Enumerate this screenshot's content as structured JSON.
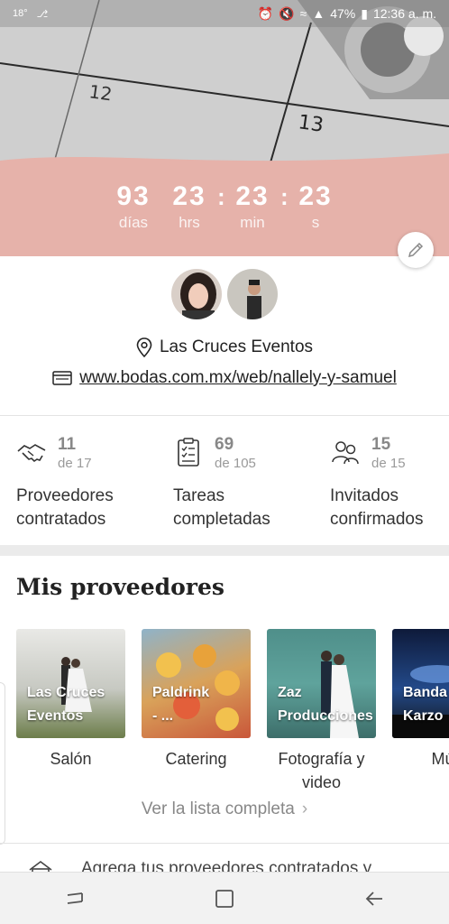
{
  "status_bar": {
    "left_icons": [
      "temperature-icon",
      "usb-icon"
    ],
    "temperature": "18°",
    "battery": "47%",
    "time": "12:36 a. m."
  },
  "hero": {
    "calendar_numbers": [
      "12",
      "13"
    ],
    "countdown": [
      {
        "value": "93",
        "label": "días"
      },
      {
        "value": "23",
        "label": "hrs"
      },
      {
        "value": "23",
        "label": "min"
      },
      {
        "value": "23",
        "label": "s"
      }
    ],
    "accent_color": "#e6b2aa"
  },
  "profile": {
    "location": "Las Cruces Eventos",
    "website": "www.bodas.com.mx/web/nallely-y-samuel"
  },
  "stats": [
    {
      "icon": "handshake-icon",
      "count": "11",
      "of": "de 17",
      "label_line1": "Proveedores",
      "label_line2": "contratados"
    },
    {
      "icon": "checklist-icon",
      "count": "69",
      "of": "de 105",
      "label_line1": "Tareas",
      "label_line2": "completadas"
    },
    {
      "icon": "guests-icon",
      "count": "15",
      "of": "de 15",
      "label_line1": "Invitados",
      "label_line2": "confirmados"
    }
  ],
  "vendors": {
    "title": "Mis proveedores",
    "items": [
      {
        "name_line1": "Las Cruces",
        "name_line2": "Eventos",
        "category_line1": "Salón",
        "category_line2": ""
      },
      {
        "name_line1": "Paldrink",
        "name_line2": "- ...",
        "category_line1": "Catering",
        "category_line2": ""
      },
      {
        "name_line1": "Zaz",
        "name_line2": "Producciones",
        "category_line1": "Fotografía y",
        "category_line2": "video"
      },
      {
        "name_line1": "Banda",
        "name_line2": "Karzo",
        "category_line1": "Mús",
        "category_line2": ""
      }
    ],
    "see_all": "Ver la lista completa"
  },
  "hint": {
    "text": "Agrega tus proveedores contratados y"
  }
}
